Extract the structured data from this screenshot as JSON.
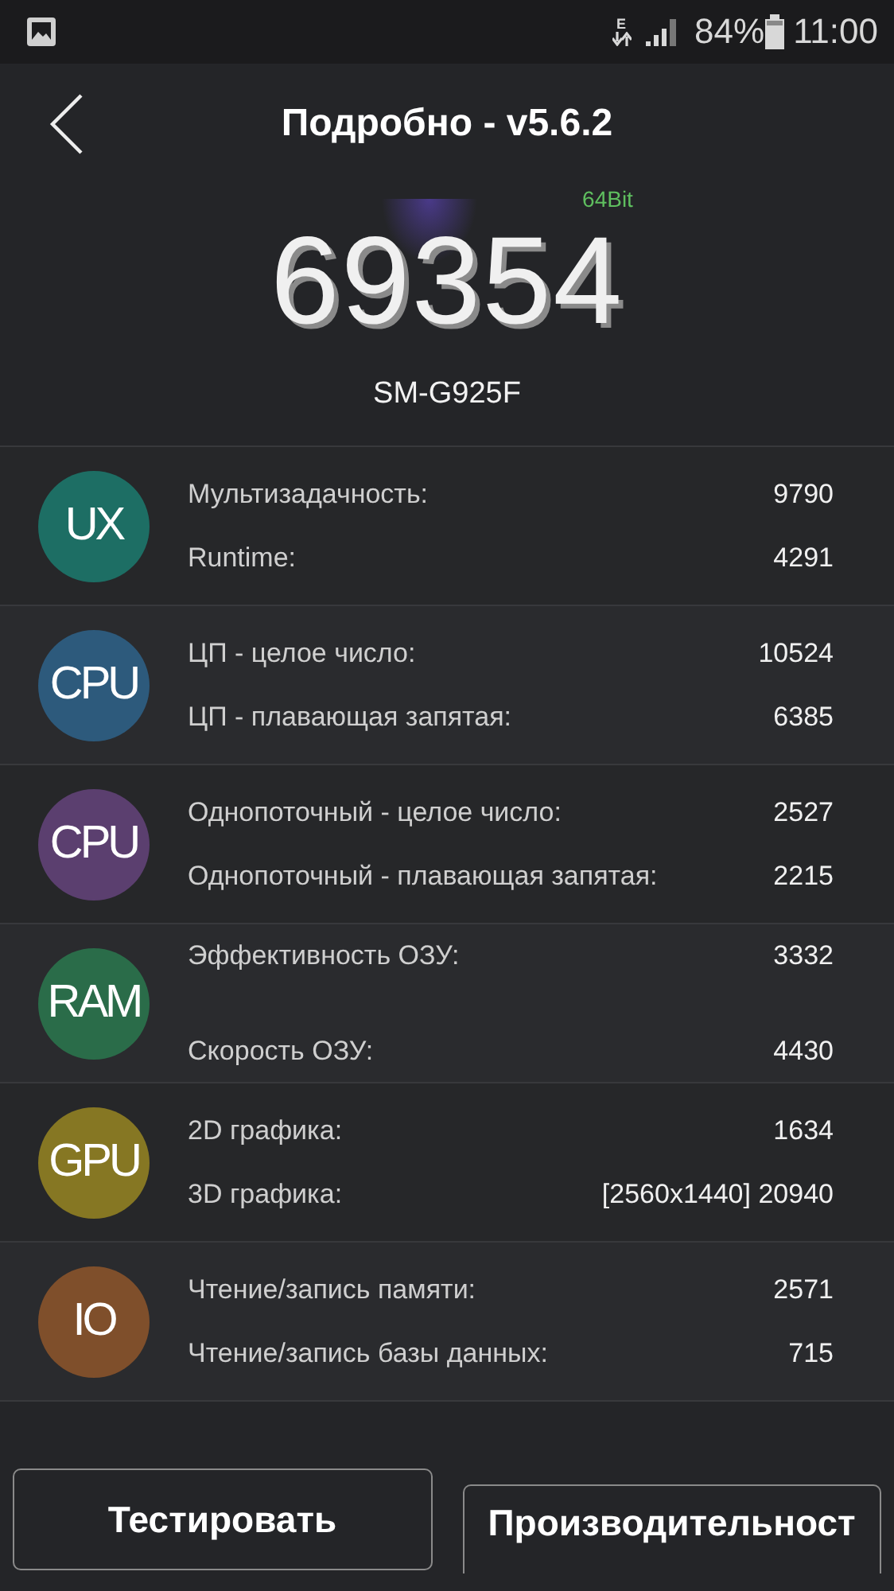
{
  "status_bar": {
    "network_type": "E",
    "battery": "84%",
    "time": "11:00"
  },
  "header": {
    "title": "Подробно - v5.6.2"
  },
  "score": {
    "total": "69354",
    "arch": "64Bit",
    "device": "SM-G925F"
  },
  "categories": [
    {
      "label": "UX",
      "color": "#1d6e64",
      "tests": [
        {
          "name": "Мультизадачность:",
          "score": "9790"
        },
        {
          "name": "Runtime:",
          "score": "4291"
        }
      ]
    },
    {
      "label": "CPU",
      "color": "#2d5a7c",
      "tests": [
        {
          "name": "ЦП - целое число:",
          "score": "10524"
        },
        {
          "name": "ЦП - плавающая запятая:",
          "score": "6385"
        }
      ]
    },
    {
      "label": "CPU",
      "color": "#5b3f6f",
      "tests": [
        {
          "name": "Однопоточный - целое число:",
          "score": "2527"
        },
        {
          "name": "Однопоточный - плавающая запятая:",
          "score": "2215"
        }
      ]
    },
    {
      "label": "RAM",
      "color": "#2a6c49",
      "tests": [
        {
          "name": "Эффективность ОЗУ:",
          "score": "3332"
        },
        {
          "name": "Скорость ОЗУ:",
          "score": "4430"
        }
      ]
    },
    {
      "label": "GPU",
      "color": "#867723",
      "tests": [
        {
          "name": "2D графика:",
          "score": "1634"
        },
        {
          "name": "3D графика:",
          "score": "[2560x1440] 20940"
        }
      ]
    },
    {
      "label": "IO",
      "color": "#7f4f2b",
      "tests": [
        {
          "name": "Чтение/запись памяти:",
          "score": "2571"
        },
        {
          "name": "Чтение/запись базы данных:",
          "score": "715"
        }
      ]
    }
  ],
  "buttons": [
    {
      "label": "Тестировать"
    },
    {
      "label": "Производительност"
    }
  ]
}
